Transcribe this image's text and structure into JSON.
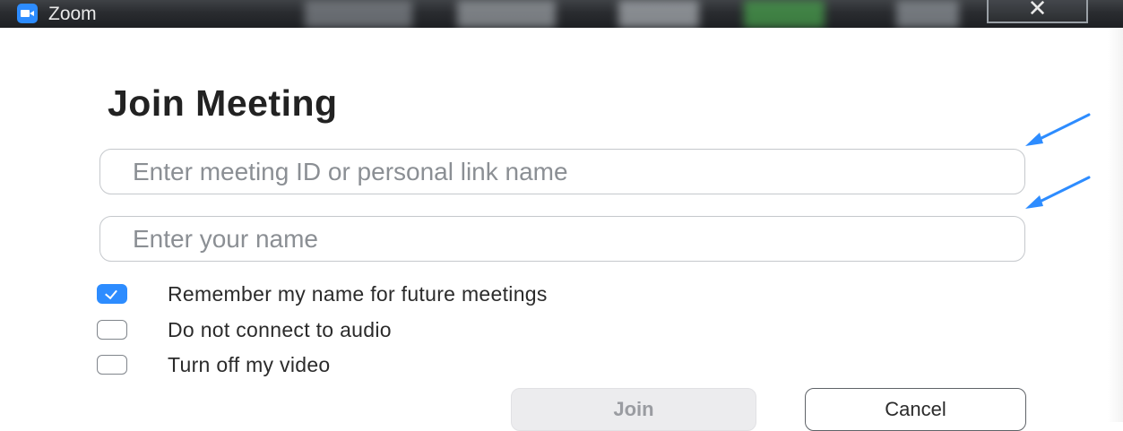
{
  "window": {
    "title": "Zoom",
    "close_glyph": "✕"
  },
  "dialog": {
    "heading": "Join Meeting"
  },
  "fields": {
    "meeting_id": {
      "placeholder": "Enter meeting ID or personal link name",
      "value": ""
    },
    "name": {
      "placeholder": "Enter your name",
      "value": ""
    }
  },
  "options": [
    {
      "label": "Remember my name for future meetings",
      "checked": true
    },
    {
      "label": "Do not connect to audio",
      "checked": false
    },
    {
      "label": "Turn off my video",
      "checked": false
    }
  ],
  "buttons": {
    "join": "Join",
    "cancel": "Cancel"
  },
  "colors": {
    "accent": "#2d8cff",
    "annotation_arrow": "#2d8cff",
    "titlebar": "#2a2c30"
  }
}
